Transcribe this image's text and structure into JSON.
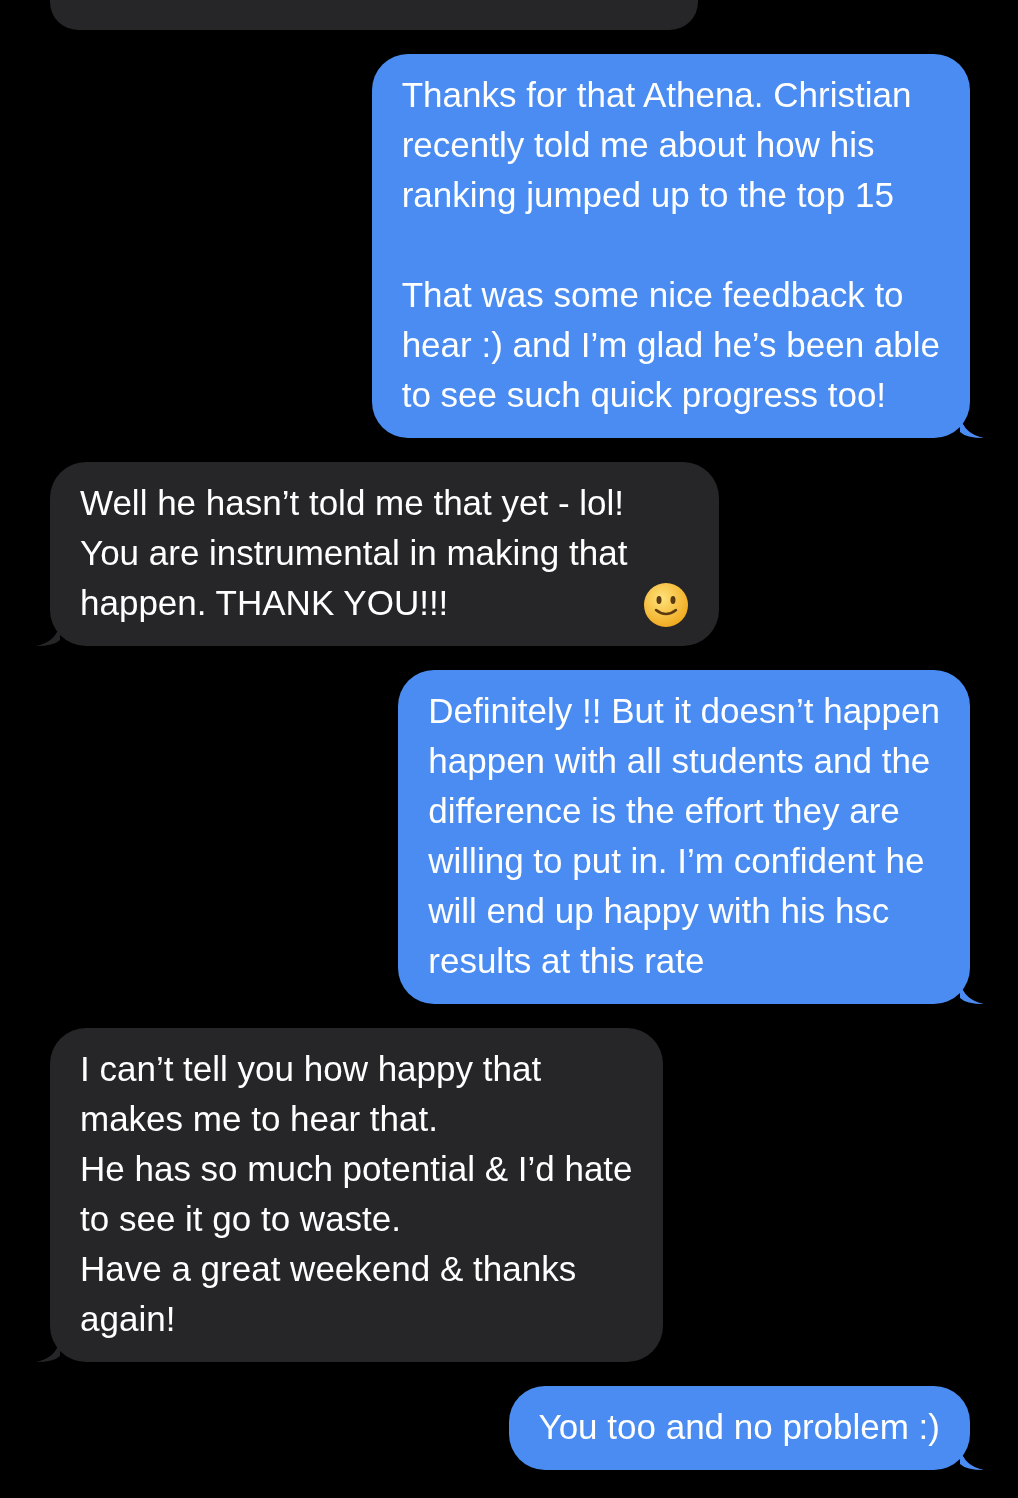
{
  "messages": [
    {
      "kind": "partial"
    },
    {
      "kind": "sent",
      "text": "Thanks for that Athena. Christian\nrecently told me about how his\nranking jumped up to the top 15\n\nThat was some nice feedback to\nhear :) and I’m glad he’s been able\nto see such quick progress too!"
    },
    {
      "kind": "received",
      "text": "Well he hasn’t told me that yet - lol!\nYou are instrumental in making that\nhappen. THANK YOU!!!",
      "emoji_after": true
    },
    {
      "kind": "sent",
      "text": "Definitely !! But it doesn’t happen\nhappen with all students and the\ndifference is the effort they are\nwilling to put in. I’m confident he\nwill end up happy with his hsc\nresults at this rate"
    },
    {
      "kind": "received",
      "text": "I can’t tell you how happy that\nmakes me to hear that.\nHe has so much potential & I’d hate\nto see it go to waste.\nHave a great weekend & thanks\nagain!"
    },
    {
      "kind": "sent",
      "text": "You too and no problem :)"
    }
  ]
}
